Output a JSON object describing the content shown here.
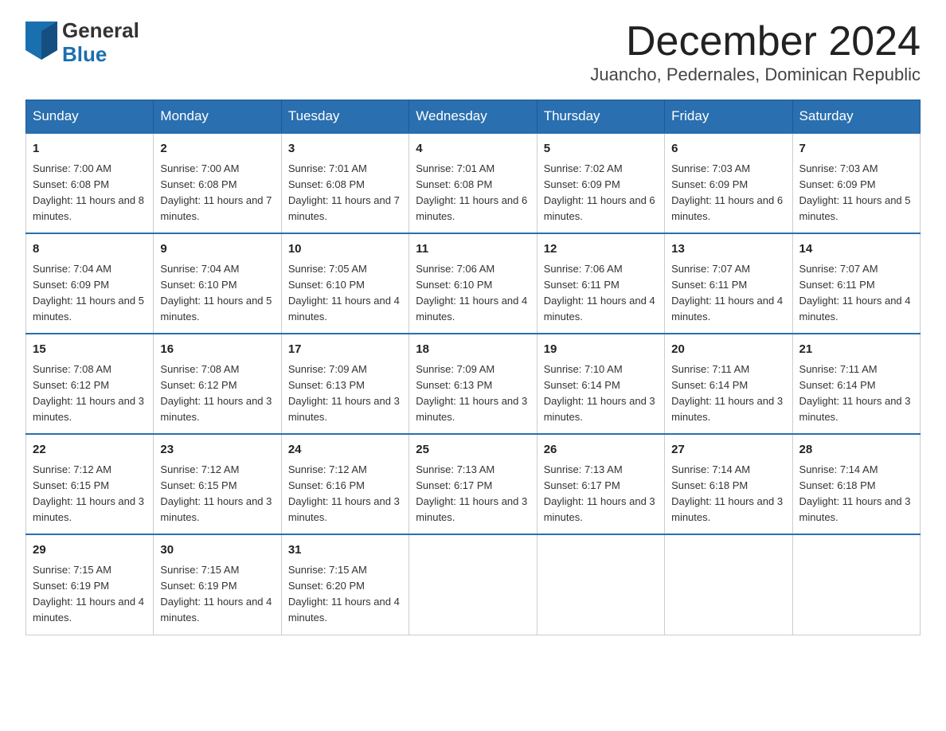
{
  "header": {
    "logo_general": "General",
    "logo_blue": "Blue",
    "month_title": "December 2024",
    "location": "Juancho, Pedernales, Dominican Republic"
  },
  "days_of_week": [
    "Sunday",
    "Monday",
    "Tuesday",
    "Wednesday",
    "Thursday",
    "Friday",
    "Saturday"
  ],
  "weeks": [
    [
      {
        "day": "1",
        "sunrise": "7:00 AM",
        "sunset": "6:08 PM",
        "daylight": "11 hours and 8 minutes."
      },
      {
        "day": "2",
        "sunrise": "7:00 AM",
        "sunset": "6:08 PM",
        "daylight": "11 hours and 7 minutes."
      },
      {
        "day": "3",
        "sunrise": "7:01 AM",
        "sunset": "6:08 PM",
        "daylight": "11 hours and 7 minutes."
      },
      {
        "day": "4",
        "sunrise": "7:01 AM",
        "sunset": "6:08 PM",
        "daylight": "11 hours and 6 minutes."
      },
      {
        "day": "5",
        "sunrise": "7:02 AM",
        "sunset": "6:09 PM",
        "daylight": "11 hours and 6 minutes."
      },
      {
        "day": "6",
        "sunrise": "7:03 AM",
        "sunset": "6:09 PM",
        "daylight": "11 hours and 6 minutes."
      },
      {
        "day": "7",
        "sunrise": "7:03 AM",
        "sunset": "6:09 PM",
        "daylight": "11 hours and 5 minutes."
      }
    ],
    [
      {
        "day": "8",
        "sunrise": "7:04 AM",
        "sunset": "6:09 PM",
        "daylight": "11 hours and 5 minutes."
      },
      {
        "day": "9",
        "sunrise": "7:04 AM",
        "sunset": "6:10 PM",
        "daylight": "11 hours and 5 minutes."
      },
      {
        "day": "10",
        "sunrise": "7:05 AM",
        "sunset": "6:10 PM",
        "daylight": "11 hours and 4 minutes."
      },
      {
        "day": "11",
        "sunrise": "7:06 AM",
        "sunset": "6:10 PM",
        "daylight": "11 hours and 4 minutes."
      },
      {
        "day": "12",
        "sunrise": "7:06 AM",
        "sunset": "6:11 PM",
        "daylight": "11 hours and 4 minutes."
      },
      {
        "day": "13",
        "sunrise": "7:07 AM",
        "sunset": "6:11 PM",
        "daylight": "11 hours and 4 minutes."
      },
      {
        "day": "14",
        "sunrise": "7:07 AM",
        "sunset": "6:11 PM",
        "daylight": "11 hours and 4 minutes."
      }
    ],
    [
      {
        "day": "15",
        "sunrise": "7:08 AM",
        "sunset": "6:12 PM",
        "daylight": "11 hours and 3 minutes."
      },
      {
        "day": "16",
        "sunrise": "7:08 AM",
        "sunset": "6:12 PM",
        "daylight": "11 hours and 3 minutes."
      },
      {
        "day": "17",
        "sunrise": "7:09 AM",
        "sunset": "6:13 PM",
        "daylight": "11 hours and 3 minutes."
      },
      {
        "day": "18",
        "sunrise": "7:09 AM",
        "sunset": "6:13 PM",
        "daylight": "11 hours and 3 minutes."
      },
      {
        "day": "19",
        "sunrise": "7:10 AM",
        "sunset": "6:14 PM",
        "daylight": "11 hours and 3 minutes."
      },
      {
        "day": "20",
        "sunrise": "7:11 AM",
        "sunset": "6:14 PM",
        "daylight": "11 hours and 3 minutes."
      },
      {
        "day": "21",
        "sunrise": "7:11 AM",
        "sunset": "6:14 PM",
        "daylight": "11 hours and 3 minutes."
      }
    ],
    [
      {
        "day": "22",
        "sunrise": "7:12 AM",
        "sunset": "6:15 PM",
        "daylight": "11 hours and 3 minutes."
      },
      {
        "day": "23",
        "sunrise": "7:12 AM",
        "sunset": "6:15 PM",
        "daylight": "11 hours and 3 minutes."
      },
      {
        "day": "24",
        "sunrise": "7:12 AM",
        "sunset": "6:16 PM",
        "daylight": "11 hours and 3 minutes."
      },
      {
        "day": "25",
        "sunrise": "7:13 AM",
        "sunset": "6:17 PM",
        "daylight": "11 hours and 3 minutes."
      },
      {
        "day": "26",
        "sunrise": "7:13 AM",
        "sunset": "6:17 PM",
        "daylight": "11 hours and 3 minutes."
      },
      {
        "day": "27",
        "sunrise": "7:14 AM",
        "sunset": "6:18 PM",
        "daylight": "11 hours and 3 minutes."
      },
      {
        "day": "28",
        "sunrise": "7:14 AM",
        "sunset": "6:18 PM",
        "daylight": "11 hours and 3 minutes."
      }
    ],
    [
      {
        "day": "29",
        "sunrise": "7:15 AM",
        "sunset": "6:19 PM",
        "daylight": "11 hours and 4 minutes."
      },
      {
        "day": "30",
        "sunrise": "7:15 AM",
        "sunset": "6:19 PM",
        "daylight": "11 hours and 4 minutes."
      },
      {
        "day": "31",
        "sunrise": "7:15 AM",
        "sunset": "6:20 PM",
        "daylight": "11 hours and 4 minutes."
      },
      null,
      null,
      null,
      null
    ]
  ]
}
